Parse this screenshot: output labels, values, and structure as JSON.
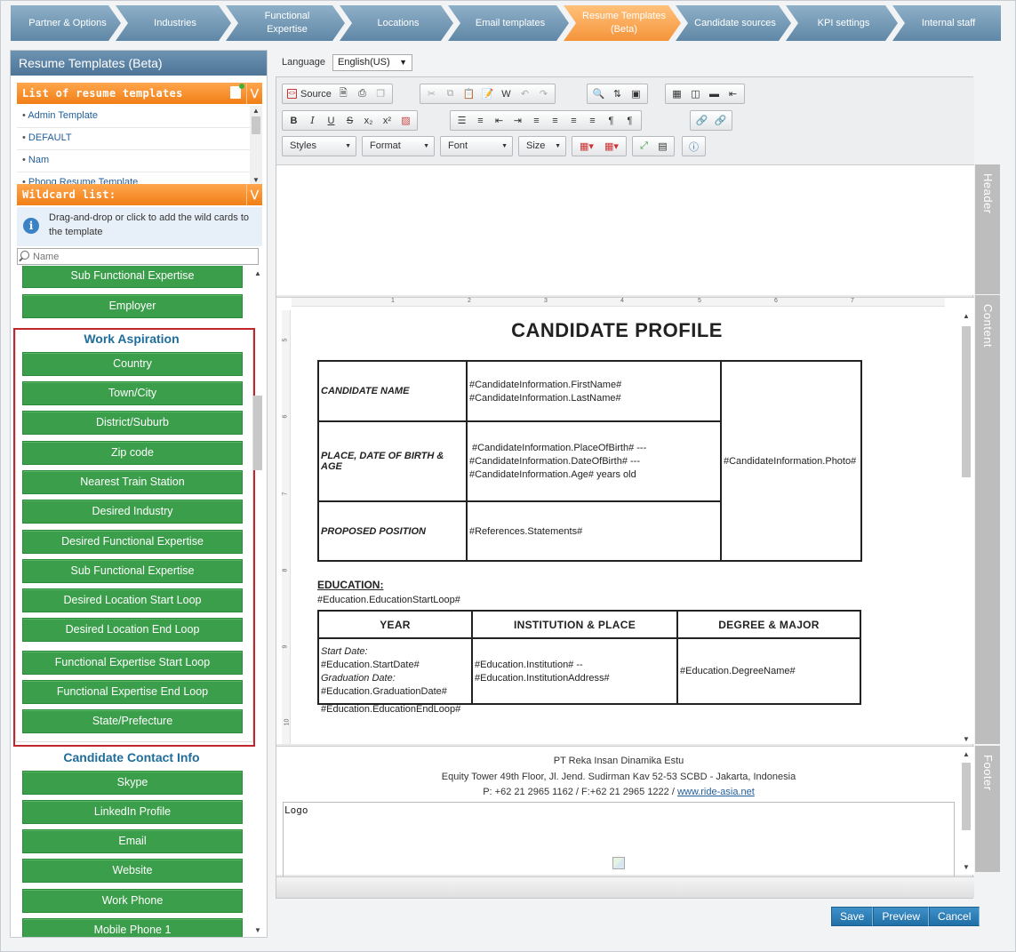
{
  "steps": [
    {
      "label": "Partner & Options"
    },
    {
      "label": "Industries"
    },
    {
      "label": "Functional\nExpertise"
    },
    {
      "label": "Locations"
    },
    {
      "label": "Email templates"
    },
    {
      "label": "Resume Templates\n(Beta)",
      "active": true
    },
    {
      "label": "Candidate sources"
    },
    {
      "label": "KPI settings"
    },
    {
      "label": "Internal staff"
    }
  ],
  "left": {
    "title": "Resume Templates (Beta)",
    "templates_header": "List of resume templates",
    "templates": [
      "Admin Template",
      "DEFAULT",
      "Nam",
      "Phong Resume Template"
    ],
    "wildcard_header": "Wildcard list:",
    "info": "Drag-and-drop or click to add the wild cards to the template",
    "search_placeholder": "Name",
    "top_items": [
      "Sub Functional Expertise",
      "Employer"
    ],
    "work_aspiration": {
      "title": "Work Aspiration",
      "items": [
        "Country",
        "Town/City",
        "District/Suburb",
        "Zip code",
        "Nearest Train Station",
        "Desired Industry",
        "Desired Functional Expertise",
        "Sub Functional Expertise",
        "Desired Location Start Loop",
        "Desired Location End Loop",
        "Functional Expertise Start Loop",
        "Functional Expertise End Loop",
        "State/Prefecture"
      ]
    },
    "contact": {
      "title": "Candidate Contact Info",
      "items": [
        "Skype",
        "LinkedIn Profile",
        "Email",
        "Website",
        "Work Phone",
        "Mobile Phone 1"
      ]
    }
  },
  "language": {
    "label": "Language",
    "value": "English(US)"
  },
  "toolbar": {
    "source": "Source",
    "styles": "Styles",
    "format": "Format",
    "font": "Font",
    "size": "Size"
  },
  "tabs": {
    "header": "Header",
    "content": "Content",
    "footer": "Footer"
  },
  "doc": {
    "title": "CANDIDATE PROFILE",
    "name_label": "CANDIDATE NAME",
    "name_value1": "#CandidateInformation.FirstName#",
    "name_value2": "#CandidateInformation.LastName#",
    "birth_label": "PLACE, DATE OF BIRTH & AGE",
    "birth_value1": "#CandidateInformation.PlaceOfBirth# ---",
    "birth_value2": "#CandidateInformation.DateOfBirth# ---",
    "birth_value3": "#CandidateInformation.Age# years old",
    "position_label": "PROPOSED POSITION",
    "position_value": "#References.Statements#",
    "photo": "#CandidateInformation.Photo#",
    "edu_heading": "EDUCATION:",
    "edu_start": "#Education.EducationStartLoop#",
    "edu_cols": [
      "YEAR",
      "INSTITUTION & PLACE",
      "DEGREE & MAJOR"
    ],
    "edu_start_label": "Start Date:",
    "edu_start_value": "#Education.StartDate#",
    "edu_grad_label": "Graduation Date:",
    "edu_grad_value": "#Education.GraduationDate#",
    "edu_inst1": "#Education.Institution# --",
    "edu_inst2": "#Education.InstitutionAddress#",
    "edu_degree": "#Education.DegreeName#",
    "edu_end": "#Education.EducationEndLoop#"
  },
  "footer": {
    "company": "PT Reka Insan Dinamika Estu",
    "address": "Equity Tower 49th Floor, Jl. Jend. Sudirman Kav 52-53 SCBD - Jakarta, Indonesia",
    "phone": "P: +62 21 2965 1162 /  F:+62 21 2965 1222 / ",
    "website": "www.ride-asia.net",
    "logo": "Logo"
  },
  "actions": {
    "save": "Save",
    "preview": "Preview",
    "cancel": "Cancel"
  },
  "ruler_h": [
    "1",
    "2",
    "3",
    "4",
    "5",
    "6",
    "7"
  ],
  "ruler_v": [
    "5",
    "6",
    "7",
    "8",
    "9",
    "10"
  ]
}
